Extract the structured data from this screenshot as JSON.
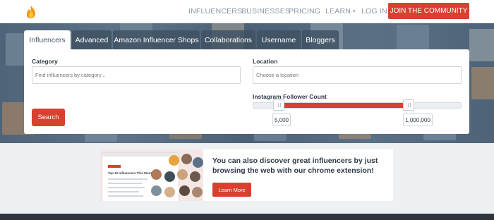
{
  "nav": {
    "links": [
      "INFLUENCERS",
      "BUSINESSES",
      "PRICING",
      "LEARN",
      "LOG IN"
    ],
    "learn_caret": "▾",
    "join_label": "JOIN THE COMMUNITY"
  },
  "tabs": [
    "Influencers",
    "Advanced",
    "Amazon Influencer Shops",
    "Collaborations",
    "Username",
    "Bloggers"
  ],
  "active_tab": "Influencers",
  "search": {
    "category_label": "Category",
    "category_placeholder": "Find influencers by category...",
    "location_label": "Location",
    "location_placeholder": "Choose a location",
    "follower_label": "Instagram Follower Count",
    "follower_min": "5,000",
    "follower_max": "1,000,000",
    "search_label": "Search"
  },
  "promo": {
    "text": "You can also discover great influencers by just browsing the web with our chrome extension!",
    "button_label": "Learn More",
    "image_heading": "Top 10 Influencers This Month"
  },
  "colors": {
    "accent": "#d8412f",
    "nav_text": "#8a97a5",
    "tab_inactive": "#3e5062",
    "footer": "#2f3640"
  },
  "icons": {
    "logo": "flame-icon"
  }
}
